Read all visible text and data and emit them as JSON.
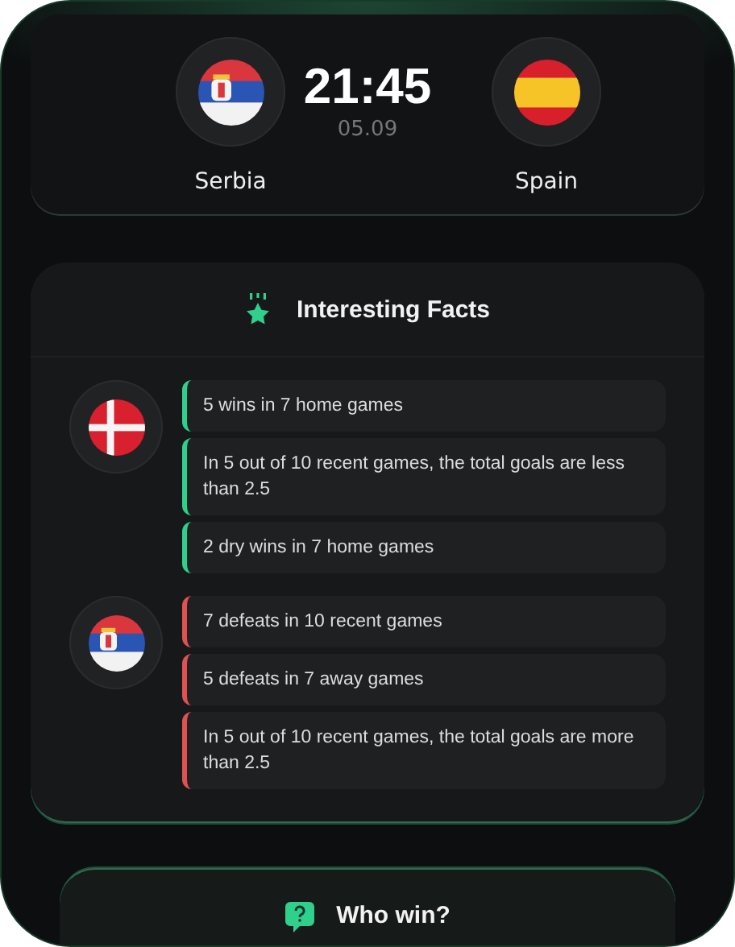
{
  "match": {
    "home": {
      "name": "Serbia",
      "flag": {
        "kind": "serbia"
      }
    },
    "time": "21:45",
    "date": "05.09",
    "away": {
      "name": "Spain",
      "flag": {
        "kind": "spain"
      }
    }
  },
  "facts": {
    "title": "Interesting Facts",
    "groups": [
      {
        "flag": {
          "kind": "denmark"
        },
        "items": [
          {
            "text": "5 wins in 7 home games",
            "color": "#2fcf8c"
          },
          {
            "text": "In 5 out of 10 recent games, the total goals are less than 2.5",
            "color": "#2fcf8c"
          },
          {
            "text": "2 dry wins in 7 home games",
            "color": "#2fcf8c"
          }
        ]
      },
      {
        "flag": {
          "kind": "serbia"
        },
        "items": [
          {
            "text": "7 defeats in 10 recent games",
            "color": "#e05252"
          },
          {
            "text": "5 defeats in 7 away games",
            "color": "#e05252"
          },
          {
            "text": "In 5 out of 10 recent games, the total goals are more than 2.5",
            "color": "#e05252"
          }
        ]
      }
    ]
  },
  "poll": {
    "title": "Who win?"
  }
}
